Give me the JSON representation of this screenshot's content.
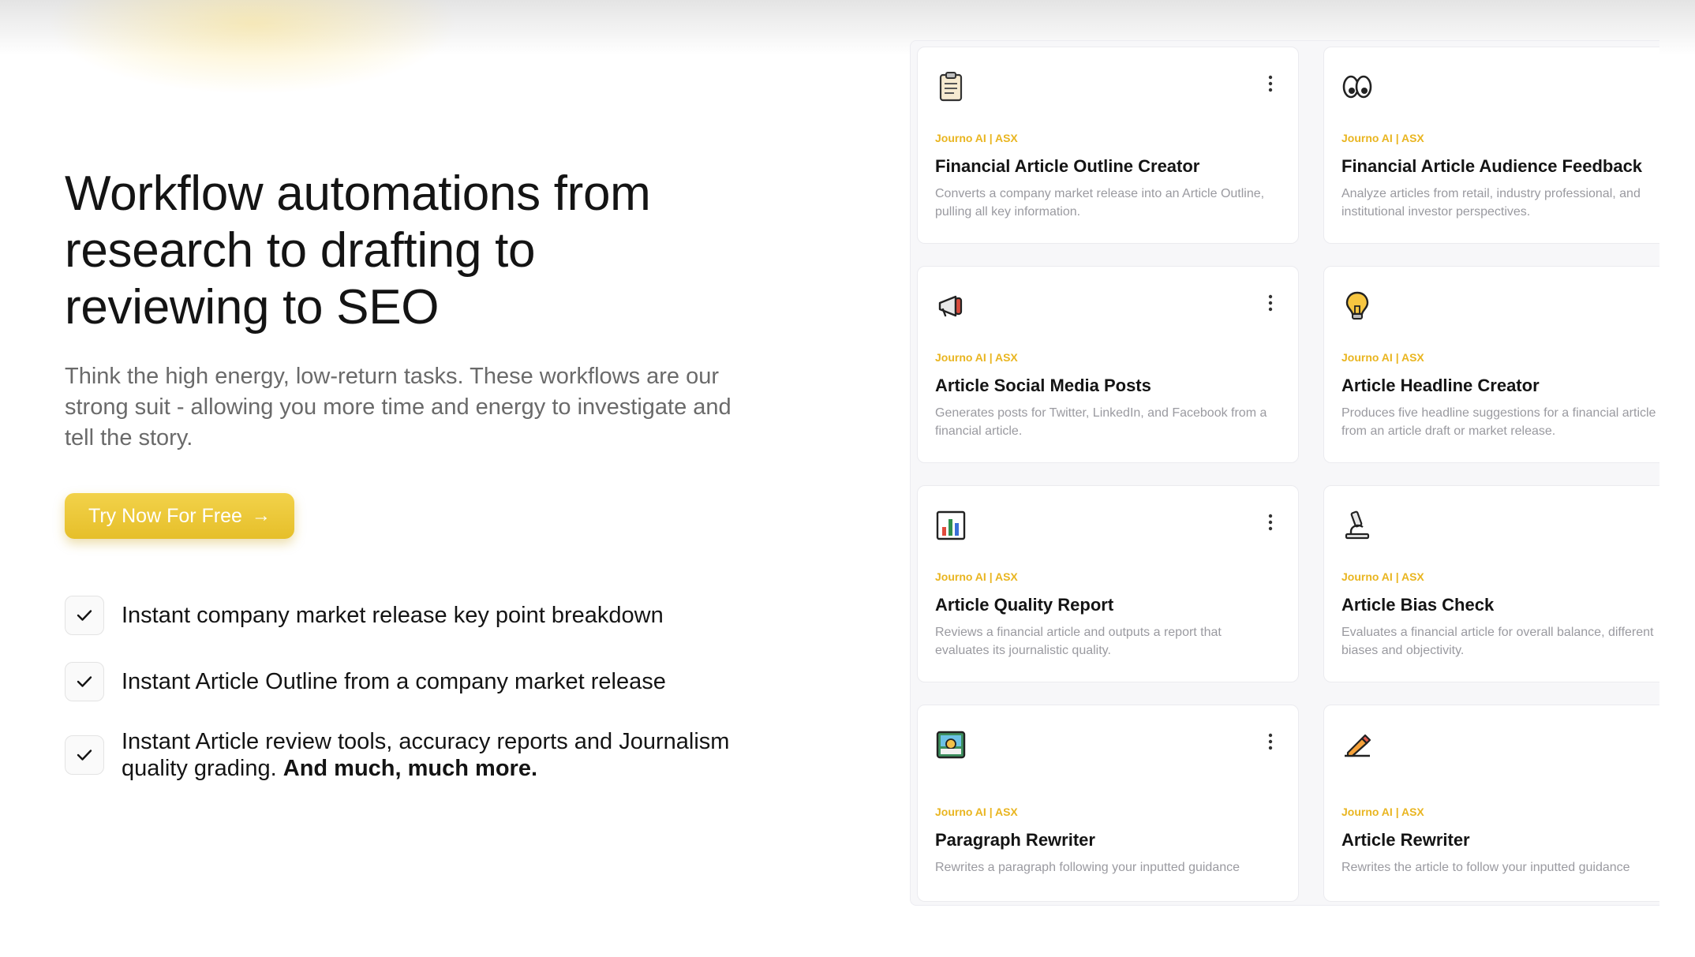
{
  "hero": {
    "headline": "Workflow automations from research to drafting to reviewing to SEO",
    "subtitle": "Think the high energy, low-return tasks. These workflows are our strong suit - allowing you more time and energy to investigate and tell the story.",
    "cta_label": "Try Now For Free",
    "cta_arrow": "→"
  },
  "features": [
    {
      "text": "Instant company market release key point breakdown"
    },
    {
      "text": "Instant Article Outline from a company market release"
    },
    {
      "text": "Instant Article review tools, accuracy reports and Journalism quality grading.",
      "bold": "And much, much more."
    }
  ],
  "cards": [
    {
      "tag": "Journo AI | ASX",
      "title": "Financial Article Outline Creator",
      "desc": "Converts a company market release into an Article Outline, pulling all key information.",
      "icon": "clipboard-icon"
    },
    {
      "tag": "Journo AI | ASX",
      "title": "Financial Article Audience Feedback",
      "desc": "Analyze articles from retail, industry professional, and institutional investor perspectives.",
      "icon": "eyes-icon"
    },
    {
      "tag": "Journo AI | ASX",
      "title": "Article Social Media Posts",
      "desc": "Generates posts for Twitter, LinkedIn, and Facebook from a financial article.",
      "icon": "megaphone-icon"
    },
    {
      "tag": "Journo AI | ASX",
      "title": "Article Headline Creator",
      "desc": "Produces five headline suggestions for a financial article from an article draft or market release.",
      "icon": "lightbulb-icon"
    },
    {
      "tag": "Journo AI | ASX",
      "title": "Article Quality Report",
      "desc": "Reviews a financial article and outputs a report that evaluates its journalistic quality.",
      "icon": "bar-chart-icon"
    },
    {
      "tag": "Journo AI | ASX",
      "title": "Article Bias Check",
      "desc": "Evaluates a financial article for overall balance, different biases and objectivity.",
      "icon": "microscope-icon"
    },
    {
      "tag": "Journo AI | ASX",
      "title": "Paragraph Rewriter",
      "desc": "Rewrites a paragraph following your inputted guidance",
      "icon": "picture-icon"
    },
    {
      "tag": "Journo AI | ASX",
      "title": "Article Rewriter",
      "desc": "Rewrites the article to follow your inputted guidance",
      "icon": "pencil-icon"
    }
  ],
  "colors": {
    "accent": "#e9b520",
    "cta": "#e6bf2a"
  }
}
